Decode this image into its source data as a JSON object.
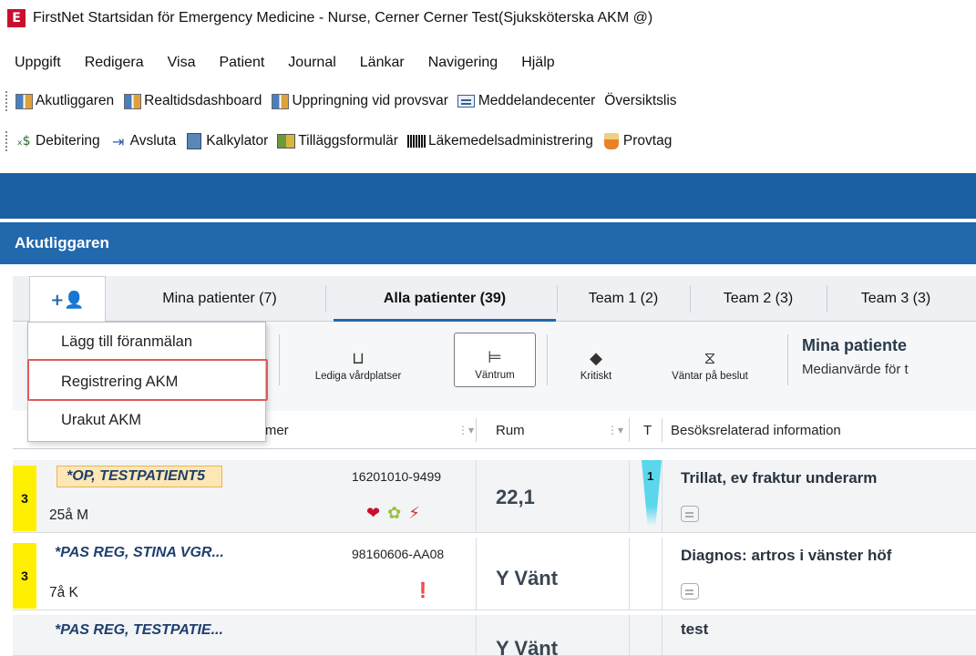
{
  "window": {
    "app_icon_letter": "E",
    "title": "FirstNet Startsidan för Emergency Medicine - Nurse, Cerner Cerner Test(Sjuksköterska AKM @)"
  },
  "menubar": [
    "Uppgift",
    "Redigera",
    "Visa",
    "Patient",
    "Journal",
    "Länkar",
    "Navigering",
    "Hjälp"
  ],
  "toolbar1": [
    {
      "label": "Akutliggaren",
      "icon": "grid-icon"
    },
    {
      "label": "Realtidsdashboard",
      "icon": "grid-icon"
    },
    {
      "label": "Uppringning vid provsvar",
      "icon": "grid-icon"
    },
    {
      "label": "Meddelandecenter",
      "icon": "message-icon"
    },
    {
      "label": "Översiktslis",
      "icon": ""
    }
  ],
  "toolbar2": [
    {
      "label": "Debitering",
      "icon": "money-icon"
    },
    {
      "label": "Avsluta",
      "icon": "exit-icon"
    },
    {
      "label": "Kalkylator",
      "icon": "calculator-icon"
    },
    {
      "label": "Tilläggsformulär",
      "icon": "form-icon"
    },
    {
      "label": "Läkemedelsadministrering",
      "icon": "barcode-icon"
    },
    {
      "label": "Provtag",
      "icon": "flask-icon"
    }
  ],
  "section": {
    "title": "Akutliggaren"
  },
  "tabs": {
    "add_icon": "+👤",
    "items": [
      {
        "label": "Mina patienter (7)"
      },
      {
        "label": "Alla patienter (39)",
        "active": true
      },
      {
        "label": "Team 1 (2)"
      },
      {
        "label": "Team 2 (3)"
      },
      {
        "label": "Team 3 (3)"
      }
    ]
  },
  "filters": [
    {
      "label": "Lediga vårdplatser",
      "icon": "⊔"
    },
    {
      "label": "Väntrum",
      "icon": "⊨",
      "selected": true
    },
    {
      "label": "Kritiskt",
      "icon": "◆"
    },
    {
      "label": "Väntar på beslut",
      "icon": "⧖"
    }
  ],
  "kpi": {
    "title": "Mina patiente",
    "subtitle": "Medianvärde för t"
  },
  "dropdown": {
    "items": [
      "Lägg till föranmälan",
      "Registrering AKM",
      "Urakut AKM"
    ],
    "highlighted_index": 1
  },
  "columns": {
    "name": "ummer",
    "room": "Rum",
    "t": "T",
    "info": "Besöksrelaterad information",
    "sort_icon": "⋮▾"
  },
  "rows": [
    {
      "priority": "3",
      "name": "*OP, TESTPATIENT5",
      "age_sex": "25å M",
      "pnr": "16201010-9499",
      "icons": [
        "❤",
        "✿",
        "⚡"
      ],
      "room": "22,1",
      "t": "1",
      "info": "Trillat, ev fraktur underarm"
    },
    {
      "priority": "3",
      "name": "*PAS REG, STINA VGR...",
      "age_sex": "7å K",
      "pnr": "98160606-AA08",
      "icons": [
        "❗"
      ],
      "room": "Y Vänt",
      "t": "",
      "info": "Diagnos: artros i vänster höf"
    },
    {
      "priority": "",
      "name": "*PAS REG, TESTPATIE...",
      "age_sex": "",
      "pnr": "",
      "icons": [],
      "room": "Y Vänt",
      "t": "",
      "info": "test"
    }
  ]
}
